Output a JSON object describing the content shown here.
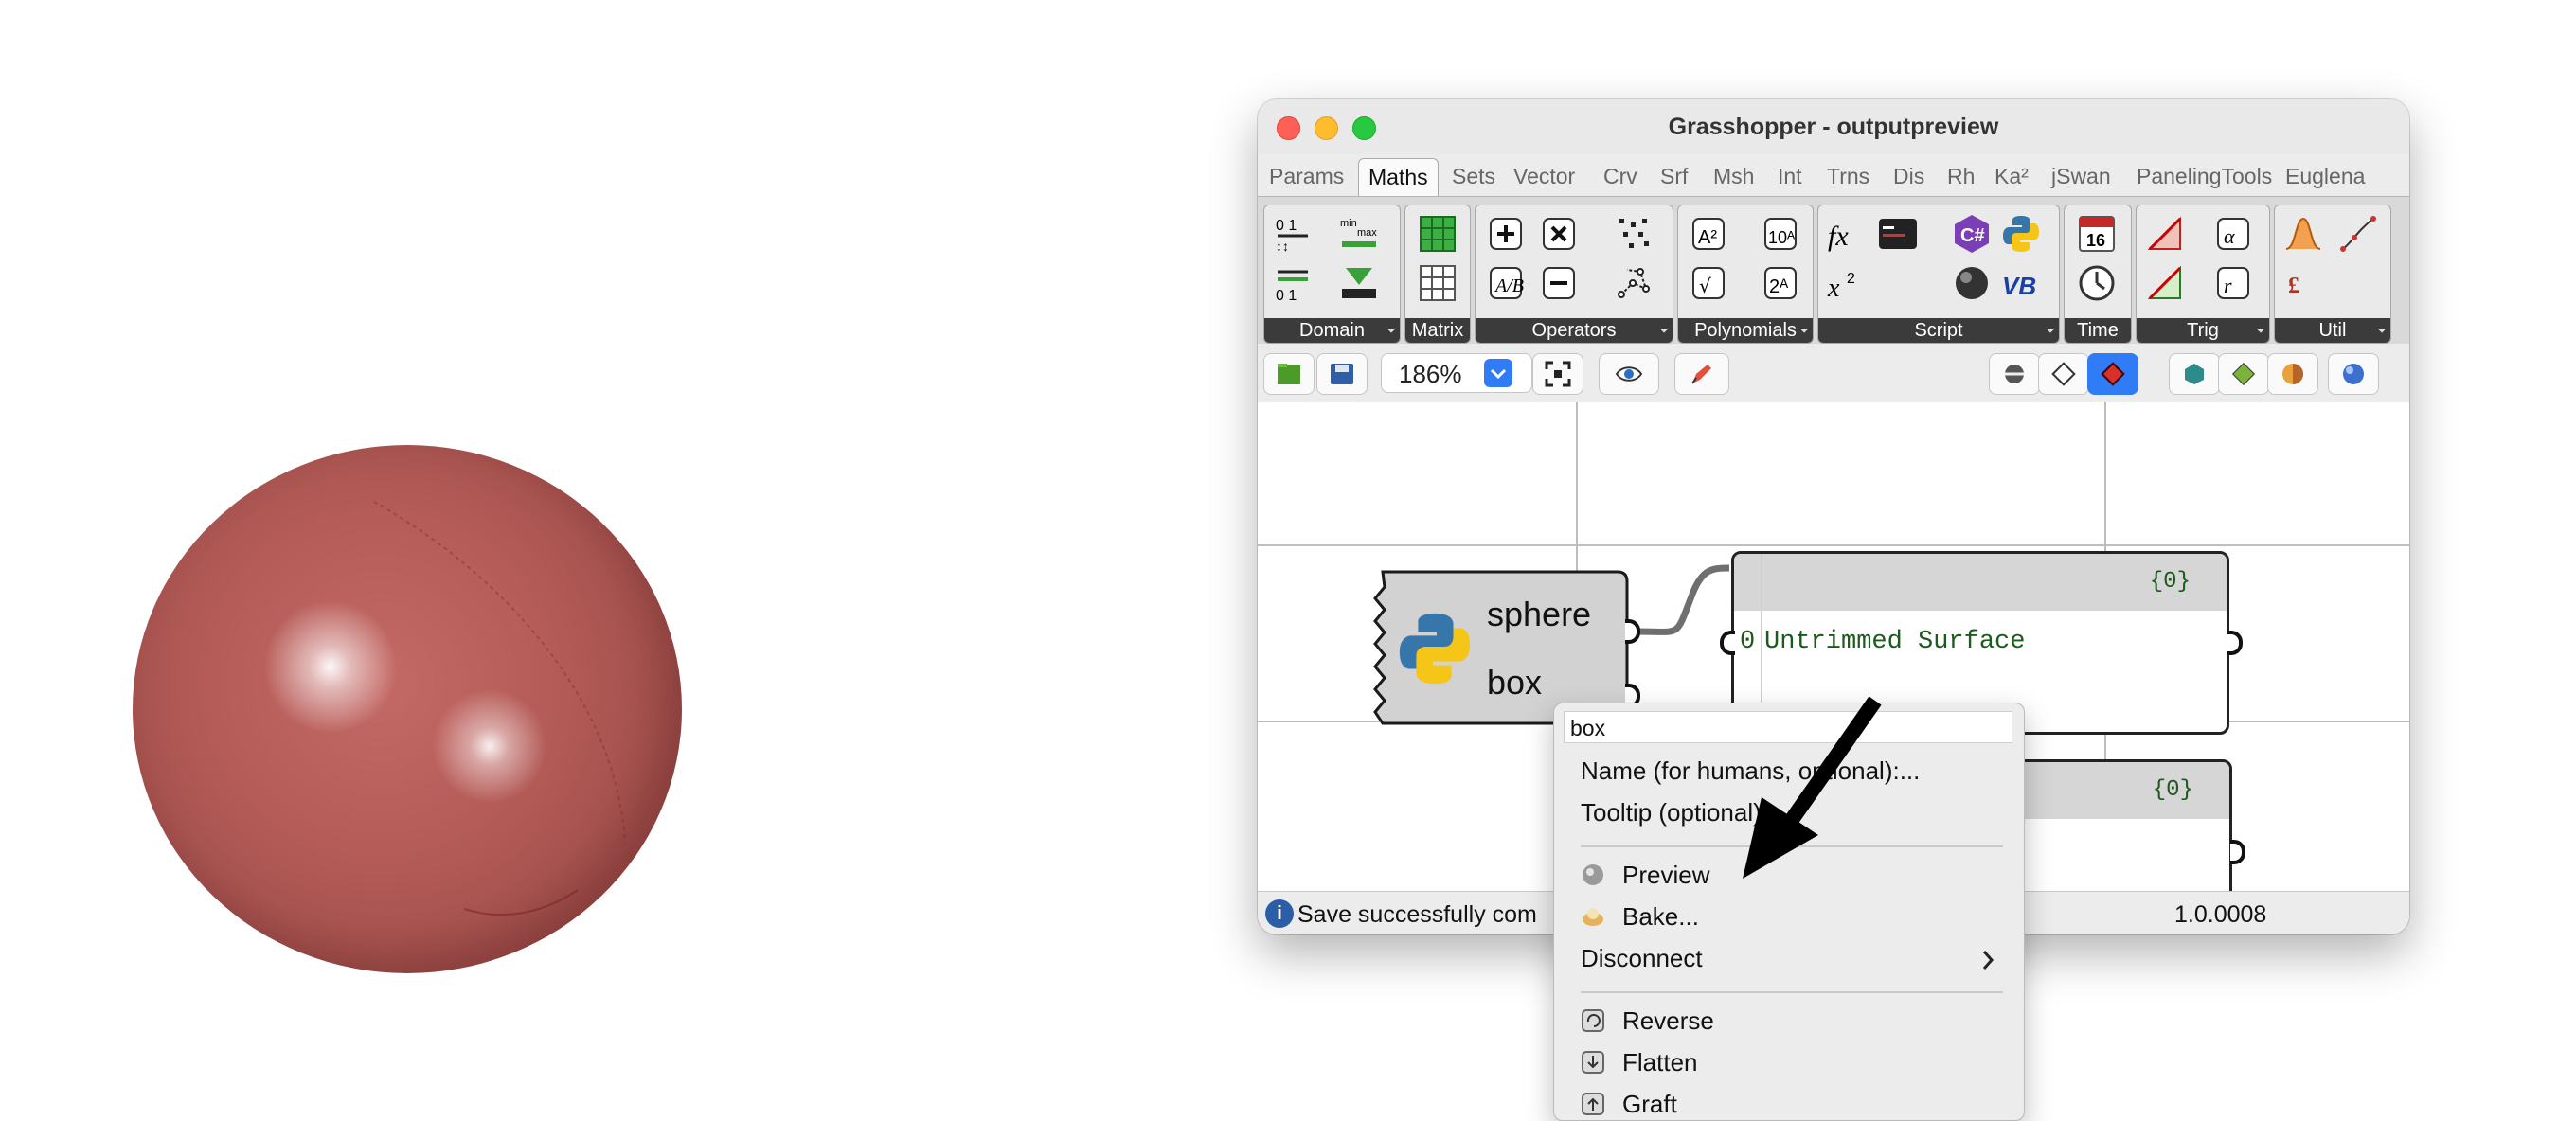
{
  "window": {
    "title": "Grasshopper - outputpreview"
  },
  "tabs": [
    "Params",
    "Maths",
    "Sets",
    "Vector",
    "Crv",
    "Srf",
    "Msh",
    "Int",
    "Trns",
    "Dis",
    "Rh",
    "Ka²",
    "jSwan",
    "PanelingTools",
    "Euglena"
  ],
  "active_tab": "Maths",
  "ribbon_groups": [
    "Domain",
    "Matrix",
    "Operators",
    "Polynomials",
    "Script",
    "Time",
    "Trig",
    "Util"
  ],
  "toolbar": {
    "zoom": "186%"
  },
  "canvas": {
    "python_component": {
      "outputs": [
        "sphere",
        "box"
      ]
    },
    "panel1": {
      "count": "{0}",
      "index": "0",
      "value": "Untrimmed Surface"
    },
    "panel2": {
      "count": "{0}"
    }
  },
  "status": {
    "text": "Save successfully com",
    "version": "1.0.0008"
  },
  "context_menu": {
    "name_field": "box",
    "items": {
      "name": "Name (for humans, optional):...",
      "tooltip": "Tooltip (optional):...",
      "preview": "Preview",
      "bake": "Bake...",
      "disconnect": "Disconnect",
      "reverse": "Reverse",
      "flatten": "Flatten",
      "graft": "Graft"
    }
  },
  "colors": {
    "sphere": "#b55c58",
    "accent": "#2f7cf6",
    "panel_text": "#1d5a1d",
    "ribbon_label_bg": "#3b3b3b"
  }
}
